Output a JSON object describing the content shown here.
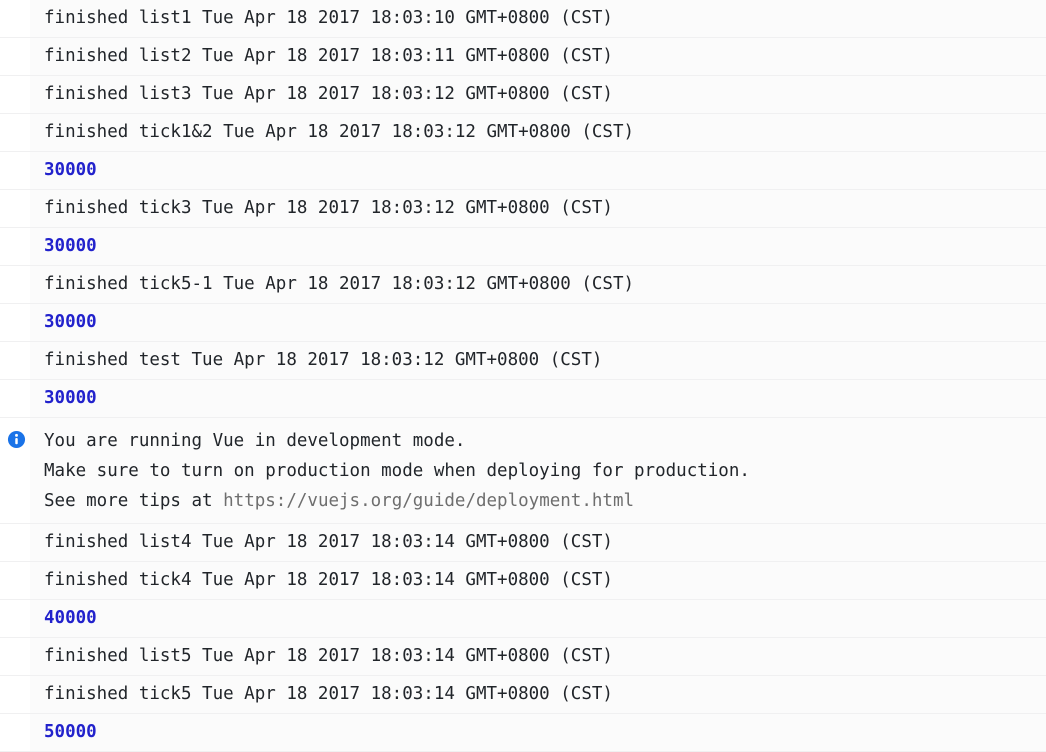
{
  "console": {
    "background_color": "#fafafa",
    "row_divider_color": "#f0f0f1",
    "log_text_color": "#21252a",
    "value_text_color": "#2222cc",
    "url_text_color": "#6e6e6e",
    "info_icon_color": "#1a73e8",
    "info_icon_name": "info-circle-icon"
  },
  "entries": [
    {
      "type": "log",
      "text": "finished list1 Tue Apr 18 2017 18:03:10 GMT+0800 (CST)"
    },
    {
      "type": "log",
      "text": "finished list2 Tue Apr 18 2017 18:03:11 GMT+0800 (CST)"
    },
    {
      "type": "log",
      "text": "finished list3 Tue Apr 18 2017 18:03:12 GMT+0800 (CST)"
    },
    {
      "type": "log",
      "text": "finished tick1&2 Tue Apr 18 2017 18:03:12 GMT+0800 (CST)"
    },
    {
      "type": "value",
      "text": "30000"
    },
    {
      "type": "log",
      "text": "finished tick3 Tue Apr 18 2017 18:03:12 GMT+0800 (CST)"
    },
    {
      "type": "value",
      "text": "30000"
    },
    {
      "type": "log",
      "text": "finished tick5-1 Tue Apr 18 2017 18:03:12 GMT+0800 (CST)"
    },
    {
      "type": "value",
      "text": "30000"
    },
    {
      "type": "log",
      "text": "finished test Tue Apr 18 2017 18:03:12 GMT+0800 (CST)"
    },
    {
      "type": "value",
      "text": "30000"
    },
    {
      "type": "info",
      "line1": "You are running Vue in development mode.",
      "line2": "Make sure to turn on production mode when deploying for production.",
      "line3_prefix": "See more tips at ",
      "line3_url": "https://vuejs.org/guide/deployment.html"
    },
    {
      "type": "log",
      "text": "finished list4 Tue Apr 18 2017 18:03:14 GMT+0800 (CST)"
    },
    {
      "type": "log",
      "text": "finished tick4 Tue Apr 18 2017 18:03:14 GMT+0800 (CST)"
    },
    {
      "type": "value",
      "text": "40000"
    },
    {
      "type": "log",
      "text": "finished list5 Tue Apr 18 2017 18:03:14 GMT+0800 (CST)"
    },
    {
      "type": "log",
      "text": "finished tick5 Tue Apr 18 2017 18:03:14 GMT+0800 (CST)"
    },
    {
      "type": "value",
      "text": "50000"
    }
  ]
}
